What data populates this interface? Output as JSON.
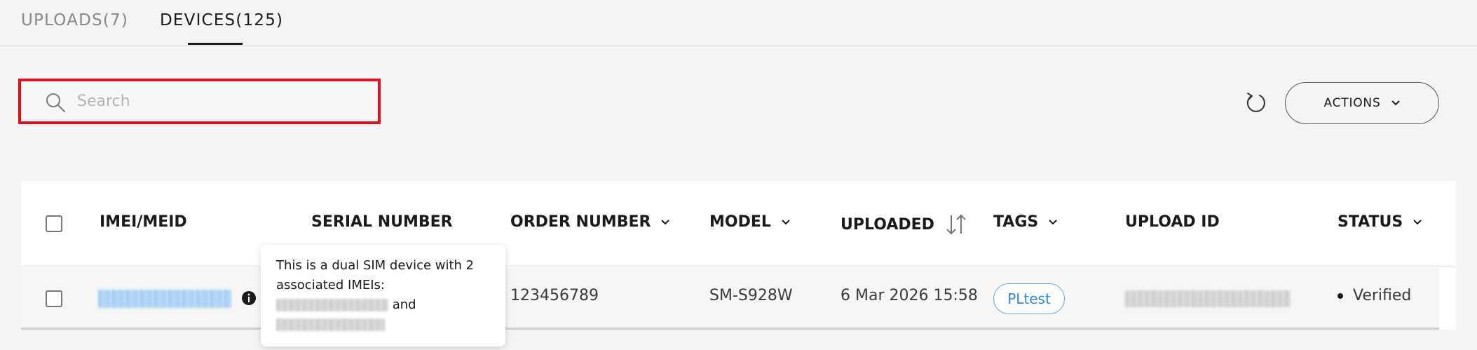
{
  "tabs": [
    {
      "label": "UPLOADS(7)",
      "active": false
    },
    {
      "label": "DEVICES(125)",
      "active": true
    }
  ],
  "search": {
    "placeholder": "Search",
    "value": ""
  },
  "toolbar": {
    "refresh_icon": "refresh-icon",
    "actions_label": "ACTIONS"
  },
  "table": {
    "columns": [
      "IMEI/MEID",
      "SERIAL NUMBER",
      "ORDER NUMBER",
      "MODEL",
      "UPLOADED",
      "TAGS",
      "UPLOAD ID",
      "STATUS"
    ],
    "rows": [
      {
        "imei": "",
        "serial": "",
        "order_number": "123456789",
        "model": "SM-S928W",
        "uploaded": "6 Mar 2026 15:58",
        "tag": "PLtest",
        "upload_id": "",
        "status": "Verified"
      }
    ]
  },
  "tooltip": {
    "line1": "This is a dual SIM device with 2",
    "line2": "associated IMEIs:",
    "conjunction": "and"
  },
  "colors": {
    "highlight": "#e0111d",
    "link": "#2a8ad6",
    "background": "#f4f4f4"
  }
}
